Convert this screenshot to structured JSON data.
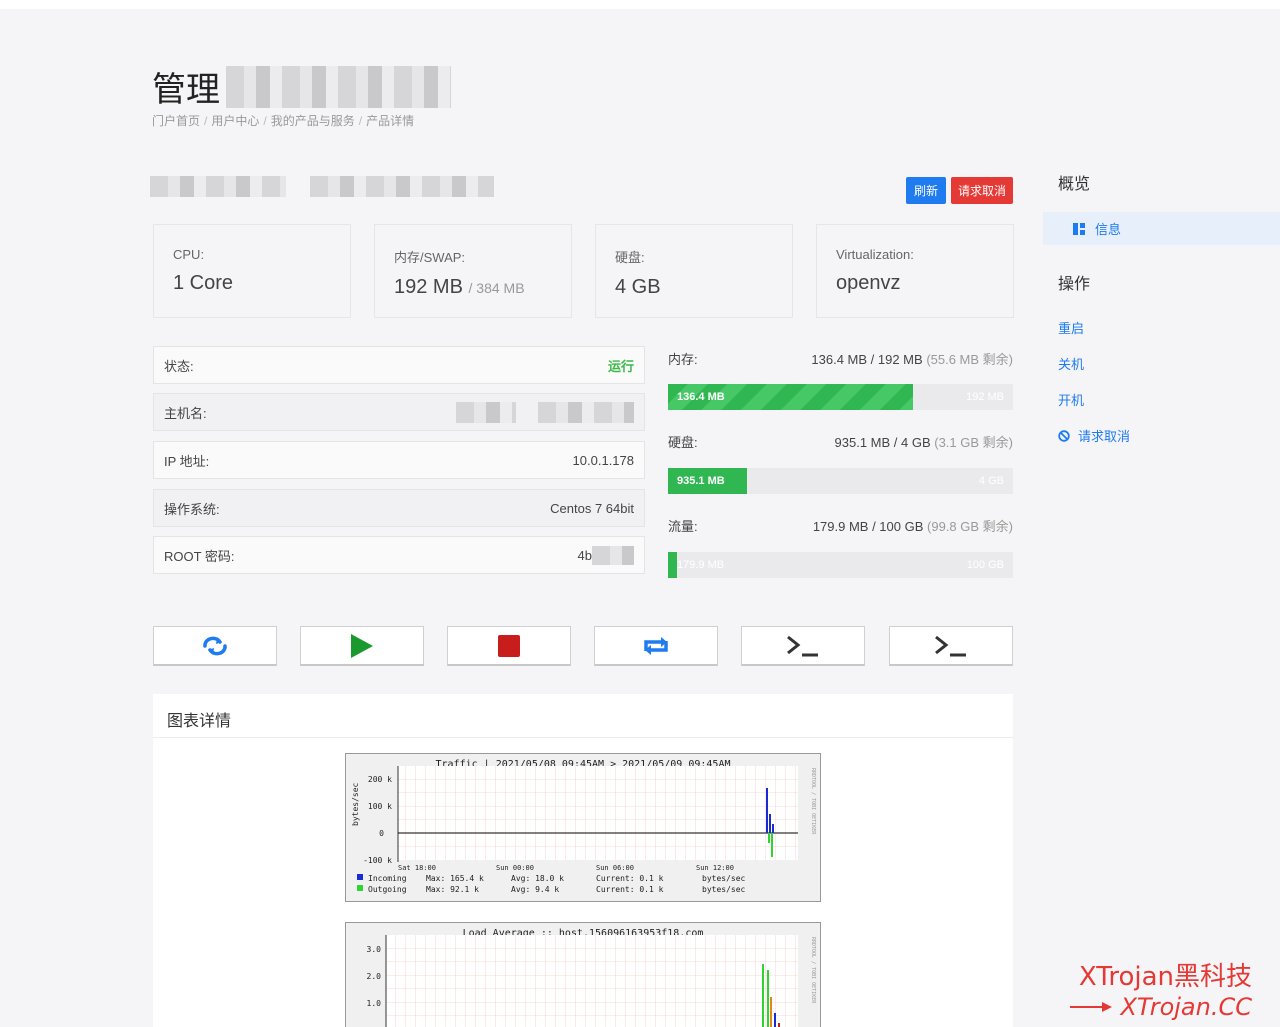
{
  "page": {
    "title": "管理"
  },
  "breadcrumb": [
    "门户首页",
    "用户中心",
    "我的产品与服务",
    "产品详情"
  ],
  "actions": {
    "refresh": "刷新",
    "cancel_request": "请求取消"
  },
  "specs": [
    {
      "label": "CPU:",
      "value": "1 Core",
      "sub": ""
    },
    {
      "label": "内存/SWAP:",
      "value": "192 MB",
      "sub": "/ 384 MB"
    },
    {
      "label": "硬盘:",
      "value": "4 GB",
      "sub": ""
    },
    {
      "label": "Virtualization:",
      "value": "openvz",
      "sub": ""
    }
  ],
  "info": {
    "status_label": "状态:",
    "status_value": "运行",
    "hostname_label": "主机名:",
    "ip_label": "IP 地址:",
    "ip_value": "10.0.1.178",
    "os_label": "操作系统:",
    "os_value": "Centos 7 64bit",
    "root_label": "ROOT 密码:",
    "root_value": "4b"
  },
  "resources": {
    "memory": {
      "label": "内存:",
      "usage": "136.4 MB / 192 MB",
      "free": "(55.6 MB 剩余)",
      "bar_text": "136.4 MB",
      "total": "192 MB",
      "fraction": 0.71
    },
    "disk": {
      "label": "硬盘:",
      "usage": "935.1 MB / 4 GB",
      "free": "(3.1 GB 剩余)",
      "bar_text": "935.1 MB",
      "total": "4 GB",
      "fraction": 0.23
    },
    "traffic": {
      "label": "流量:",
      "usage": "179.9 MB / 100 GB",
      "free": "(99.8 GB 剩余)",
      "bar_text": "179.9 MB",
      "total": "100 GB",
      "fraction": 0.0018
    }
  },
  "control_buttons": [
    "reboot-icon",
    "play-icon",
    "stop-icon",
    "reinstall-icon",
    "console-icon",
    "terminal-icon"
  ],
  "charts_panel": {
    "title": "图表详情"
  },
  "traffic_graph": {
    "title": "Traffic | 2021/05/08 09:45AM > 2021/05/09 09:45AM",
    "ylabel": "bytes/sec",
    "yticks": [
      "200 k",
      "100 k",
      "0",
      "-100 k"
    ],
    "xticks": [
      "Sat 18:00",
      "Sun 00:00",
      "Sun 06:00",
      "Sun 12:00"
    ],
    "side_text": "RRDTOOL / TOBI OETIKER",
    "legend": [
      {
        "name": "Incoming",
        "max": "Max: 165.4 k",
        "avg": "Avg: 18.0 k",
        "current": "Current: 0.1 k",
        "unit": "bytes/sec",
        "color": "#1a2bd6"
      },
      {
        "name": "Outgoing",
        "max": "Max: 92.1 k",
        "avg": "Avg: 9.4 k",
        "current": "Current: 0.1 k",
        "unit": "bytes/sec",
        "color": "#2fd42f"
      }
    ]
  },
  "load_graph": {
    "title": "Load Average :: host.156096163953f18.com",
    "yticks": [
      "3.0",
      "2.0",
      "1.0"
    ],
    "side_text": "RRDTOOL / TOBI OETIKER"
  },
  "sidebar": {
    "overview_heading": "概览",
    "info_item": "信息",
    "ops_heading": "操作",
    "ops": [
      "重启",
      "关机",
      "开机",
      "请求取消"
    ]
  },
  "watermark": {
    "line1": "XTrojan黑科技",
    "line2": "XTrojan.CC"
  }
}
